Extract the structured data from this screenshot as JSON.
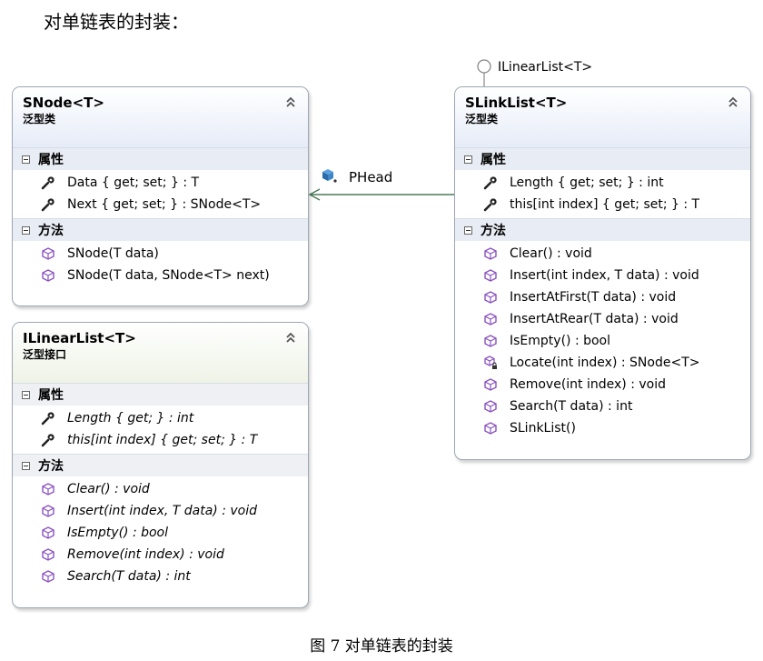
{
  "heading": "对单链表的封装：",
  "caption": "图 7  对单链表的封装",
  "association": {
    "label": "PHead"
  },
  "interface_lollipop": {
    "label": "ILinearList<T>"
  },
  "snode": {
    "name": "SNode<T>",
    "kind": "泛型类",
    "sections": [
      {
        "title": "属性",
        "members": [
          "Data { get; set; } : T",
          "Next { get; set; } : SNode<T>"
        ]
      },
      {
        "title": "方法",
        "members": [
          "SNode(T data)",
          "SNode(T data, SNode<T> next)"
        ]
      }
    ]
  },
  "ilinearlist": {
    "name": "ILinearList<T>",
    "kind": "泛型接口",
    "sections": [
      {
        "title": "属性",
        "members": [
          "Length { get; } : int",
          "this[int index] { get; set; } : T"
        ]
      },
      {
        "title": "方法",
        "members": [
          "Clear() : void",
          "Insert(int index, T data) : void",
          "IsEmpty() : bool",
          "Remove(int index) : void",
          "Search(T data) : int"
        ]
      }
    ]
  },
  "slinklist": {
    "name": "SLinkList<T>",
    "kind": "泛型类",
    "sections": [
      {
        "title": "属性",
        "members": [
          "Length { get; set; } : int",
          "this[int index] { get; set; } : T"
        ]
      },
      {
        "title": "方法",
        "members": [
          "Clear() : void",
          "Insert(int index, T data) : void",
          "InsertAtFirst(T data) : void",
          "InsertAtRear(T data) : void",
          "IsEmpty() : bool",
          "Locate(int index) : SNode<T>",
          "Remove(int index) : void",
          "Search(T data) : int",
          "SLinkList()"
        ]
      }
    ]
  },
  "colors": {
    "connector": "#4a7a58",
    "method_icon": "#8a52c0",
    "border": "#9ea7b3"
  },
  "icons": {
    "property": "wrench-icon",
    "method": "method-cube-icon",
    "private_method": "private-method-icon",
    "collapse": "double-chevron-up-icon",
    "field": "field-icon"
  }
}
